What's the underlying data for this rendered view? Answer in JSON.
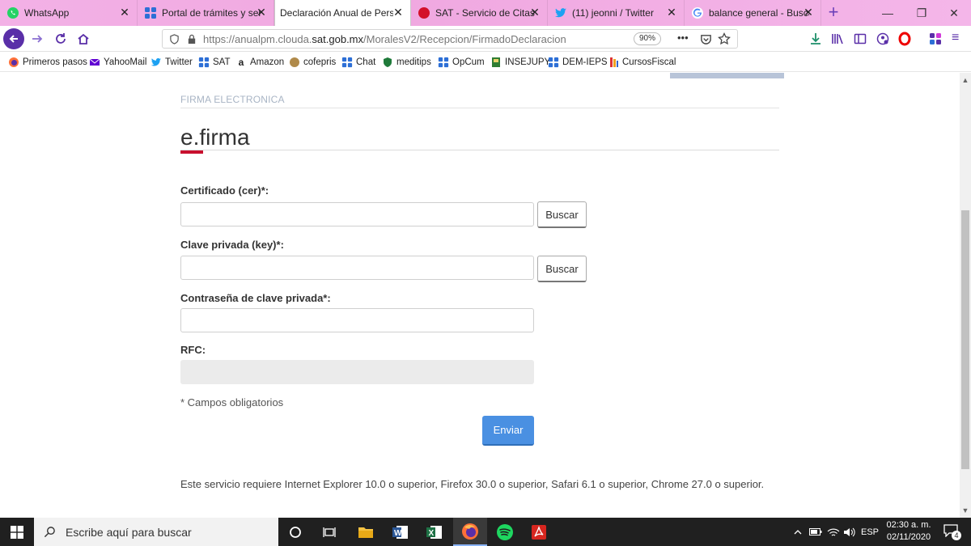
{
  "browser": {
    "tabs": [
      {
        "title": "WhatsApp",
        "active": false
      },
      {
        "title": "Portal de trámites y servi",
        "active": false
      },
      {
        "title": "Declaración Anual de Person",
        "active": true
      },
      {
        "title": "SAT - Servicio de Citas",
        "active": false
      },
      {
        "title": "(11) jeonni / Twitter",
        "active": false
      },
      {
        "title": "balance general - Buscar",
        "active": false
      }
    ],
    "url_prefix": "https://anualpm.clouda.",
    "url_host": "sat.gob.mx",
    "url_path": "/MoralesV2/Recepcion/FirmadoDeclaracion",
    "zoom": "90%",
    "bookmarks": [
      "Primeros pasos",
      "YahooMail",
      "Twitter",
      "SAT",
      "Amazon",
      "cofepris",
      "Chat",
      "meditips",
      "OpCum",
      "INSEJUPY",
      "DEM-IEPS",
      "CursosFiscal"
    ]
  },
  "page": {
    "section_label": "FIRMA ELECTRONICA",
    "title": "e.firma",
    "fields": {
      "cer_label": "Certificado (cer)*:",
      "key_label": "Clave privada (key)*:",
      "password_label": "Contraseña de clave privada*:",
      "rfc_label": "RFC:"
    },
    "buttons": {
      "browse_cer": "Buscar",
      "browse_key": "Buscar",
      "submit": "Enviar"
    },
    "required_note": "* Campos obligatorios",
    "browser_requirements": "Este servicio requiere Internet Explorer 10.0 o superior, Firefox 30.0 o superior, Safari 6.1 o superior, Chrome 27.0 o superior."
  },
  "taskbar": {
    "search_placeholder": "Escribe aquí para buscar",
    "language": "ESP",
    "time": "02:30 a. m.",
    "date": "02/11/2020",
    "notification_count": "4"
  },
  "colors": {
    "accent_red": "#c8102e",
    "submit_blue": "#4a90e2",
    "tab_bar_pink": "#f0a8e0",
    "firefox_purple": "#5a2fa8"
  }
}
